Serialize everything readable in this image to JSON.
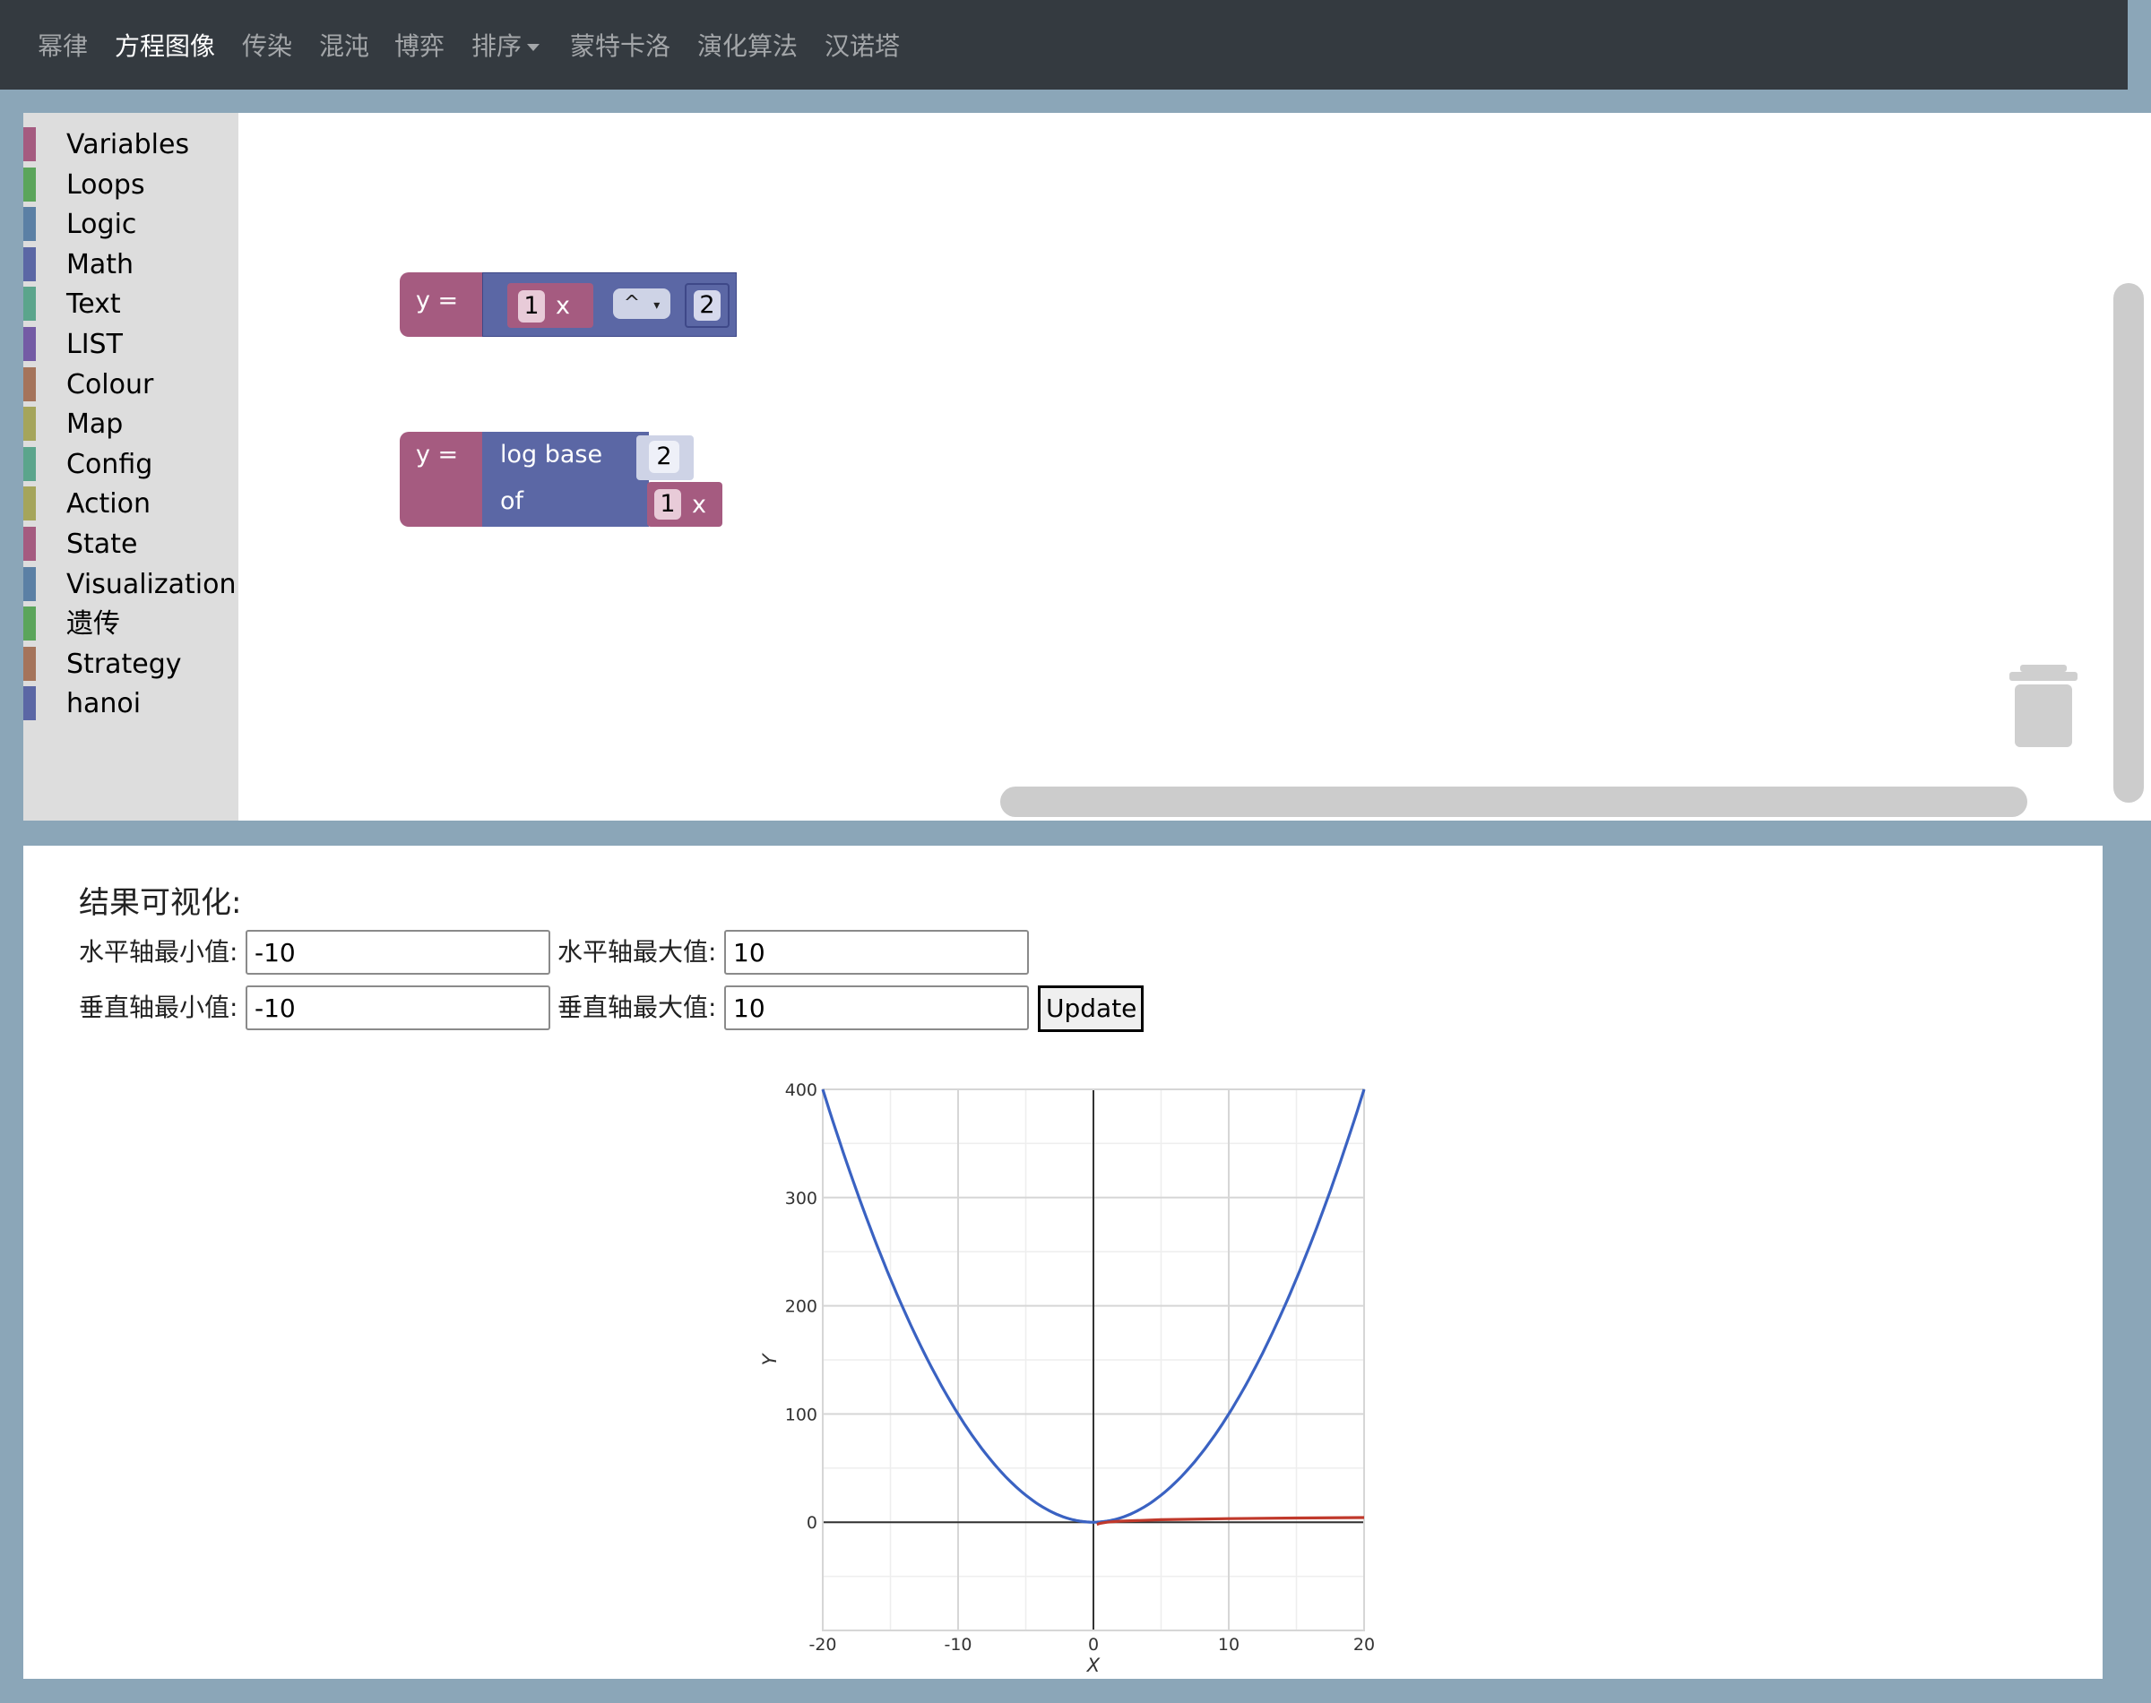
{
  "navbar": {
    "items": [
      {
        "label": "幂律",
        "active": false
      },
      {
        "label": "方程图像",
        "active": true
      },
      {
        "label": "传染",
        "active": false
      },
      {
        "label": "混沌",
        "active": false
      },
      {
        "label": "博弈",
        "active": false
      },
      {
        "label": "排序",
        "active": false,
        "dropdown": true
      },
      {
        "label": "蒙特卡洛",
        "active": false
      },
      {
        "label": "演化算法",
        "active": false
      },
      {
        "label": "汉诺塔",
        "active": false
      }
    ]
  },
  "toolbox": {
    "categories": [
      {
        "label": "Variables",
        "color": "#a55b80"
      },
      {
        "label": "Loops",
        "color": "#5ba55b"
      },
      {
        "label": "Logic",
        "color": "#5b80a5"
      },
      {
        "label": "Math",
        "color": "#5b67a5"
      },
      {
        "label": "Text",
        "color": "#5ba58c"
      },
      {
        "label": "LIST",
        "color": "#745ba5"
      },
      {
        "label": "Colour",
        "color": "#a5745b"
      },
      {
        "label": "Map",
        "color": "#a5a55b"
      },
      {
        "label": "Config",
        "color": "#5ba58c"
      },
      {
        "label": "Action",
        "color": "#a5a55b"
      },
      {
        "label": "State",
        "color": "#a55b80"
      },
      {
        "label": "Visualization",
        "color": "#5b80a5"
      },
      {
        "label": "遗传",
        "color": "#5ba55b"
      },
      {
        "label": "Strategy",
        "color": "#a5745b"
      },
      {
        "label": "hanoi",
        "color": "#5b67a5"
      }
    ]
  },
  "blocks": {
    "block1": {
      "prefix": "y =",
      "num": "1",
      "var": "x",
      "op": "^",
      "op_arrow": "▾",
      "exp": "2"
    },
    "block2": {
      "prefix": "y =",
      "log_label": "log base",
      "base": "2",
      "of_label": "of",
      "num": "1",
      "var": "x"
    }
  },
  "result": {
    "title": "结果可视化:",
    "x_min_label": "水平轴最小值:",
    "x_min_value": "-10",
    "x_max_label": "水平轴最大值:",
    "x_max_value": "10",
    "y_min_label": "垂直轴最小值:",
    "y_min_value": "-10",
    "y_max_label": "垂直轴最大值:",
    "y_max_value": "10",
    "update_label": "Update"
  },
  "chart_data": {
    "type": "line",
    "xlabel": "X",
    "ylabel": "Y",
    "xlim": [
      -20,
      20
    ],
    "ylim": [
      -100,
      400
    ],
    "xticks": [
      -20,
      -10,
      0,
      10,
      20
    ],
    "yticks": [
      0,
      100,
      200,
      300,
      400
    ],
    "grid": true,
    "series": [
      {
        "color": "#3a62c2",
        "points": [
          [
            -20,
            400
          ],
          [
            -15,
            225
          ],
          [
            -10,
            100
          ],
          [
            -5,
            25
          ],
          [
            0,
            0
          ],
          [
            5,
            25
          ],
          [
            10,
            100
          ],
          [
            15,
            225
          ],
          [
            20,
            400
          ]
        ]
      },
      {
        "color": "#c0392b",
        "points": [
          [
            0.25,
            -2
          ],
          [
            0.5,
            -1
          ],
          [
            1,
            0
          ],
          [
            2,
            1
          ],
          [
            5,
            2.32
          ],
          [
            10,
            3.32
          ],
          [
            15,
            3.91
          ],
          [
            20,
            4.32
          ]
        ]
      }
    ]
  }
}
